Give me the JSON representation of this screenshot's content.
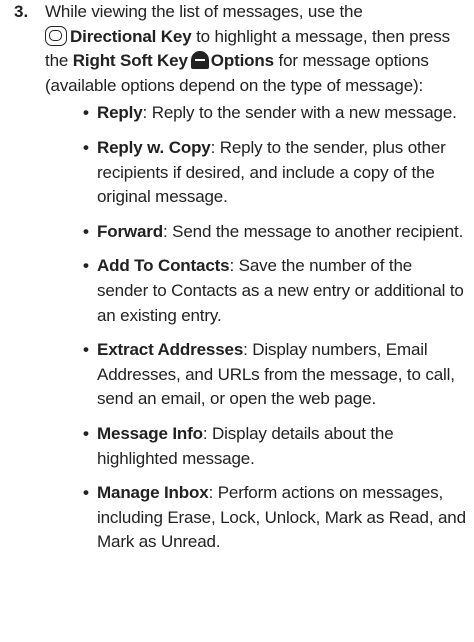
{
  "step": {
    "number": "3.",
    "intro_1": "While viewing the list of messages, use the",
    "directional_key_label": "Directional Key",
    "intro_2": " to highlight a message, then press the ",
    "right_soft_key_label": "Right Soft Key",
    "options_label": "Options",
    "intro_3": " for message options (available options depend on the type of message):"
  },
  "options": [
    {
      "term": "Reply",
      "desc": ": Reply to the sender with a new message."
    },
    {
      "term": "Reply w. Copy",
      "desc": ": Reply to the sender, plus other recipients if desired, and include a copy of the original message."
    },
    {
      "term": "Forward",
      "desc": ": Send the message to another recipient."
    },
    {
      "term": "Add To Contacts",
      "desc": ": Save the number of the sender to Contacts as a new entry or additional to an existing entry."
    },
    {
      "term": "Extract Addresses",
      "desc": ": Display numbers, Email Addresses, and URLs from the message, to call, send an email, or open the web page."
    },
    {
      "term": "Message Info",
      "desc": ": Display details about the highlighted message."
    },
    {
      "term": "Manage Inbox",
      "desc": ": Perform actions on messages, including Erase, Lock, Unlock, Mark as Read, and Mark as Unread."
    }
  ],
  "icons": {
    "directional_key": "directional-key-icon",
    "right_soft_key": "right-soft-key-icon"
  }
}
